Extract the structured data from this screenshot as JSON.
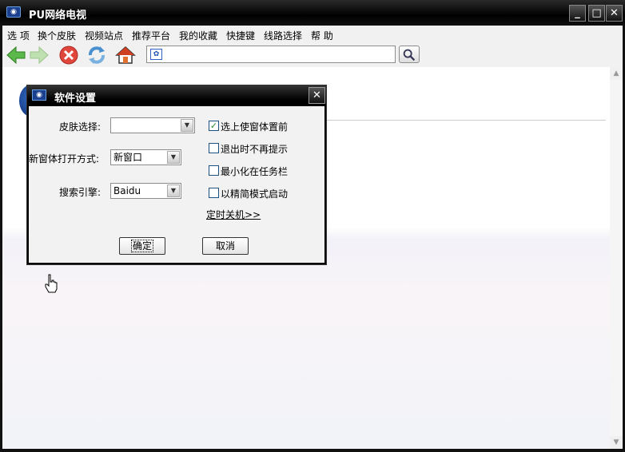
{
  "window": {
    "title": "PU网络电视"
  },
  "menu": {
    "items": [
      "选 项",
      "换个皮肤",
      "视频站点",
      "推荐平台",
      "我的收藏",
      "快捷键",
      "线路选择",
      "帮 助"
    ]
  },
  "toolbar": {
    "back_icon": "back-arrow-icon",
    "forward_icon": "forward-arrow-icon",
    "stop_icon": "stop-icon",
    "refresh_icon": "refresh-icon",
    "home_icon": "home-icon",
    "address_value": ""
  },
  "dialog": {
    "title": "软件设置",
    "skin_label": "皮肤选择:",
    "skin_value": "",
    "window_label": "新窗体打开方式:",
    "window_value": "新窗口",
    "search_label": "搜索引擎:",
    "search_value": "Baidu",
    "options": [
      {
        "label": "选上使窗体置前",
        "checked": true
      },
      {
        "label": "退出时不再提示",
        "checked": false
      },
      {
        "label": "最小化在任务栏",
        "checked": false
      },
      {
        "label": "以精简模式启动",
        "checked": false
      }
    ],
    "timer_link": "定时关机>>",
    "ok_label": "确定",
    "cancel_label": "取消"
  },
  "colors": {
    "titlebar": "#000000",
    "dialog_body": "#f2f2f2"
  }
}
